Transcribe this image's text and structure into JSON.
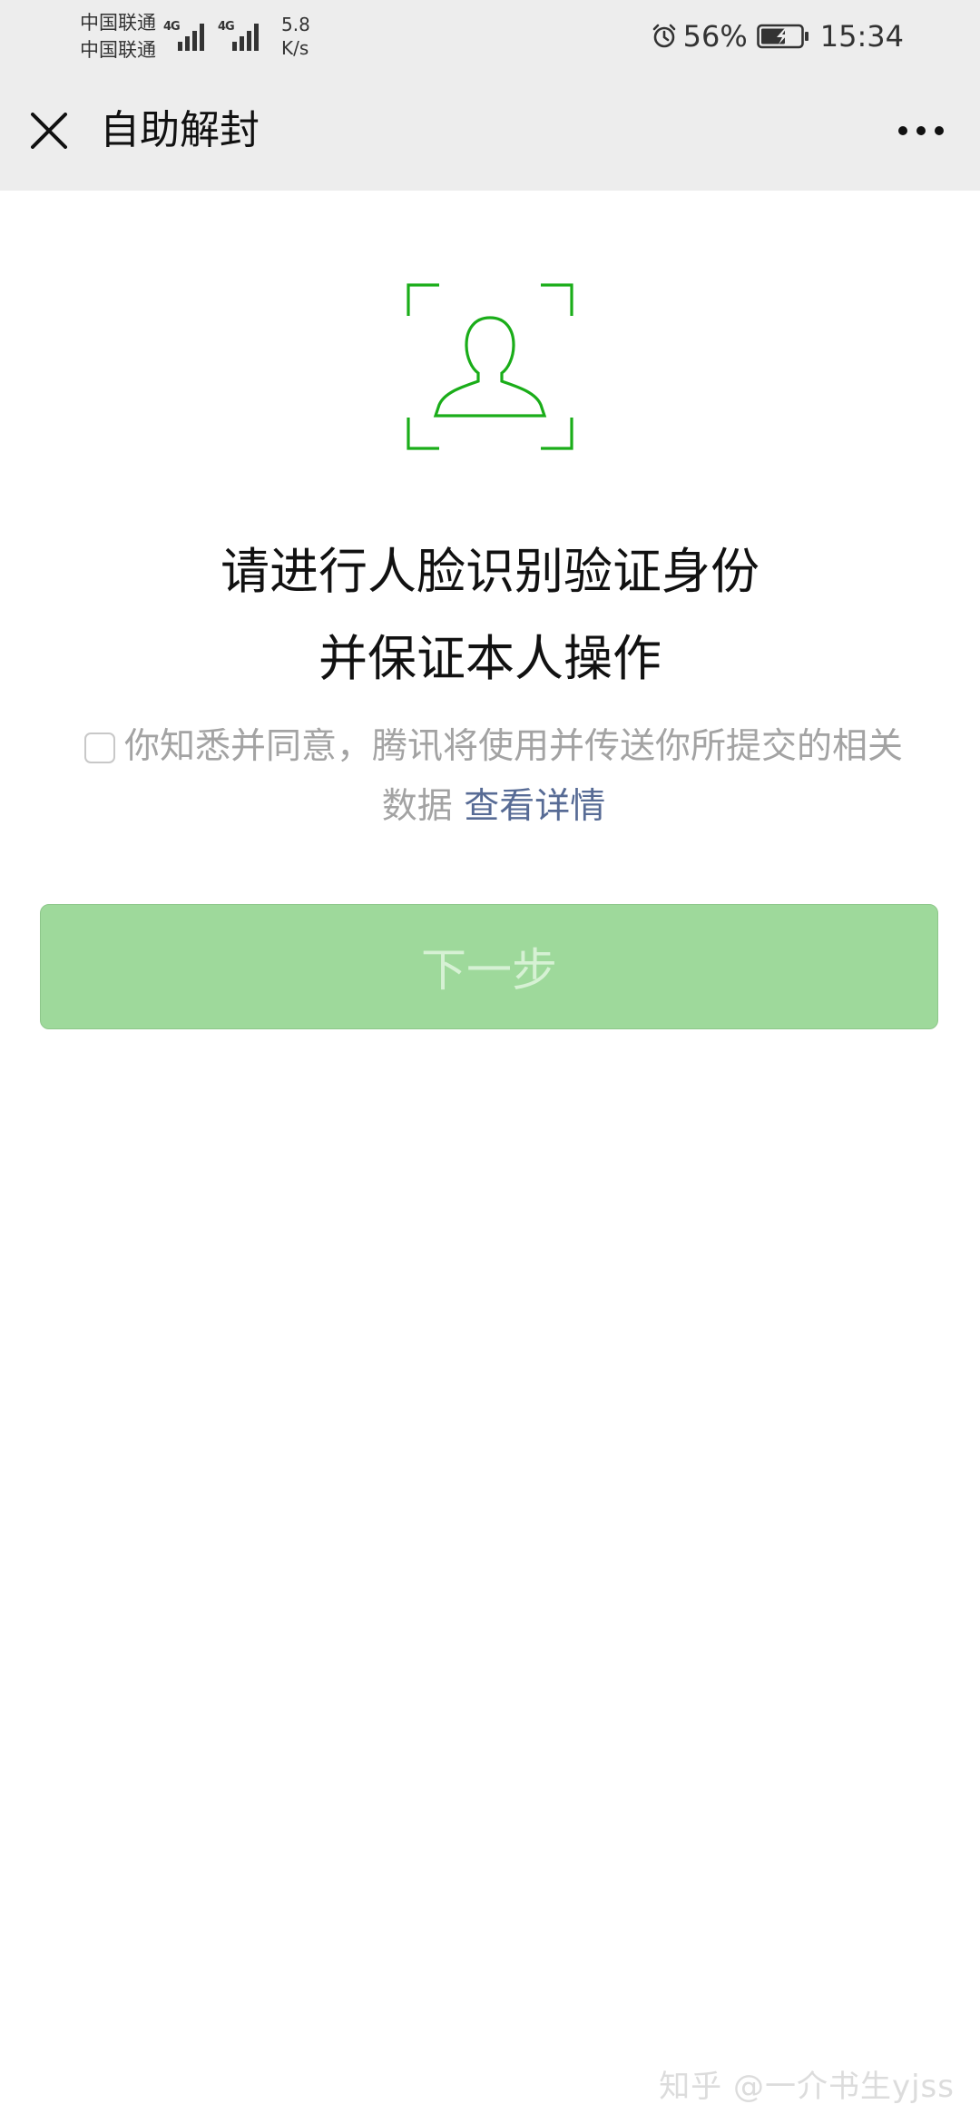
{
  "status_bar": {
    "carrier_1": "中国联通",
    "carrier_2": "中国联通",
    "network_1": "4G",
    "network_2": "4G",
    "speed_value": "5.8",
    "speed_unit": "K/s",
    "battery": "56%",
    "time": "15:34",
    "icons": [
      "alarm-icon",
      "battery-charging-icon",
      "signal-icon"
    ]
  },
  "title_bar": {
    "title": "自助解封",
    "close_icon": "close-icon",
    "more_icon": "more-icon"
  },
  "main": {
    "face_icon": "face-scan-icon",
    "heading_line_1": "请进行人脸识别验证身份",
    "heading_line_2": "并保证本人操作",
    "consent_text": "你知悉并同意，腾讯将使用并传送你所提交的相关数据",
    "consent_link": "查看详情",
    "next_button": "下一步"
  },
  "colors": {
    "accent_green": "#07c160",
    "button_disabled_bg": "#9ed99b",
    "link_blue": "#576b95",
    "title_bar_bg": "#ededed"
  },
  "watermark": "知乎 @一介书生yjss"
}
